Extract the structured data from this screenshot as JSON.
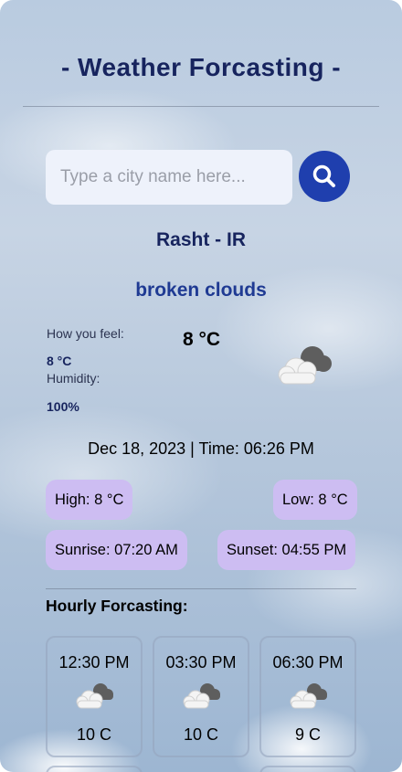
{
  "app": {
    "title": "- Weather Forcasting -"
  },
  "search": {
    "placeholder": "Type a city name here...",
    "value": "",
    "icon": "search-icon"
  },
  "current": {
    "city": "Rasht - IR",
    "description": "broken clouds",
    "feels_label": "How you feel:",
    "feels_value": "8 °C",
    "humidity_label": "Humidity:",
    "humidity_value": "100%",
    "temperature": "8 °C",
    "icon": "broken-clouds-icon",
    "datetime": "Dec 18, 2023 | Time: 06:26 PM",
    "high": "High: 8 °C",
    "low": "Low: 8 °C",
    "sunrise": "Sunrise: 07:20 AM",
    "sunset": "Sunset: 04:55 PM"
  },
  "hourly": {
    "title": "Hourly Forcasting:",
    "items": [
      {
        "time": "12:30 PM",
        "temp": "10 C",
        "icon": "broken-clouds-icon"
      },
      {
        "time": "03:30 PM",
        "temp": "10 C",
        "icon": "broken-clouds-icon"
      },
      {
        "time": "06:30 PM",
        "temp": "9 C",
        "icon": "broken-clouds-icon"
      }
    ]
  },
  "colors": {
    "title": "#17245e",
    "accent": "#1f3fae",
    "description": "#1f3a93",
    "pill": "#cdbdf2"
  }
}
